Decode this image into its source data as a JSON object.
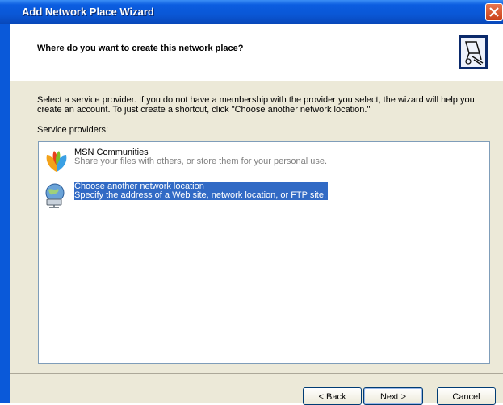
{
  "window": {
    "title": "Add Network Place Wizard"
  },
  "header": {
    "title": "Where do you want to create this network place?"
  },
  "body": {
    "description": "Select a service provider.  If you do not have a membership with the provider you select, the wizard will help you create an account.  To just create a shortcut, click \"Choose another network location.\"",
    "providers_label": "Service providers:",
    "providers": [
      {
        "title": "MSN Communities",
        "subtitle": "Share your files with others, or store them for your personal use.",
        "icon": "msn-butterfly-icon",
        "selected": false
      },
      {
        "title": "Choose another network location",
        "subtitle": "Specify the address of a Web site, network location, or FTP site.",
        "icon": "network-globe-icon",
        "selected": true
      }
    ]
  },
  "buttons": {
    "back": "< Back",
    "next": "Next >",
    "cancel": "Cancel"
  },
  "colors": {
    "title_bar": "#0a57d6",
    "selection": "#316ac5",
    "dialog_face": "#ece9d8"
  }
}
